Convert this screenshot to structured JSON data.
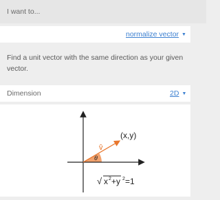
{
  "header": {
    "prompt": "I want to..."
  },
  "operation": {
    "selected": "normalize vector"
  },
  "description": "Find a unit vector with the same direction as your given vector.",
  "dimension": {
    "label": "Dimension",
    "selected": "2D"
  },
  "diagram": {
    "point_label": "(x,y)",
    "vector_label": "v̂",
    "angle_label": "θ",
    "equation_sqrt": "√",
    "equation_x": "x",
    "equation_x_exp": "2",
    "equation_plus": "+y",
    "equation_y_exp": "2",
    "equation_rhs": "=1"
  },
  "colors": {
    "accent": "#3b7fd0",
    "vector": "#e8762c",
    "angle_fill": "#f2a26d"
  }
}
